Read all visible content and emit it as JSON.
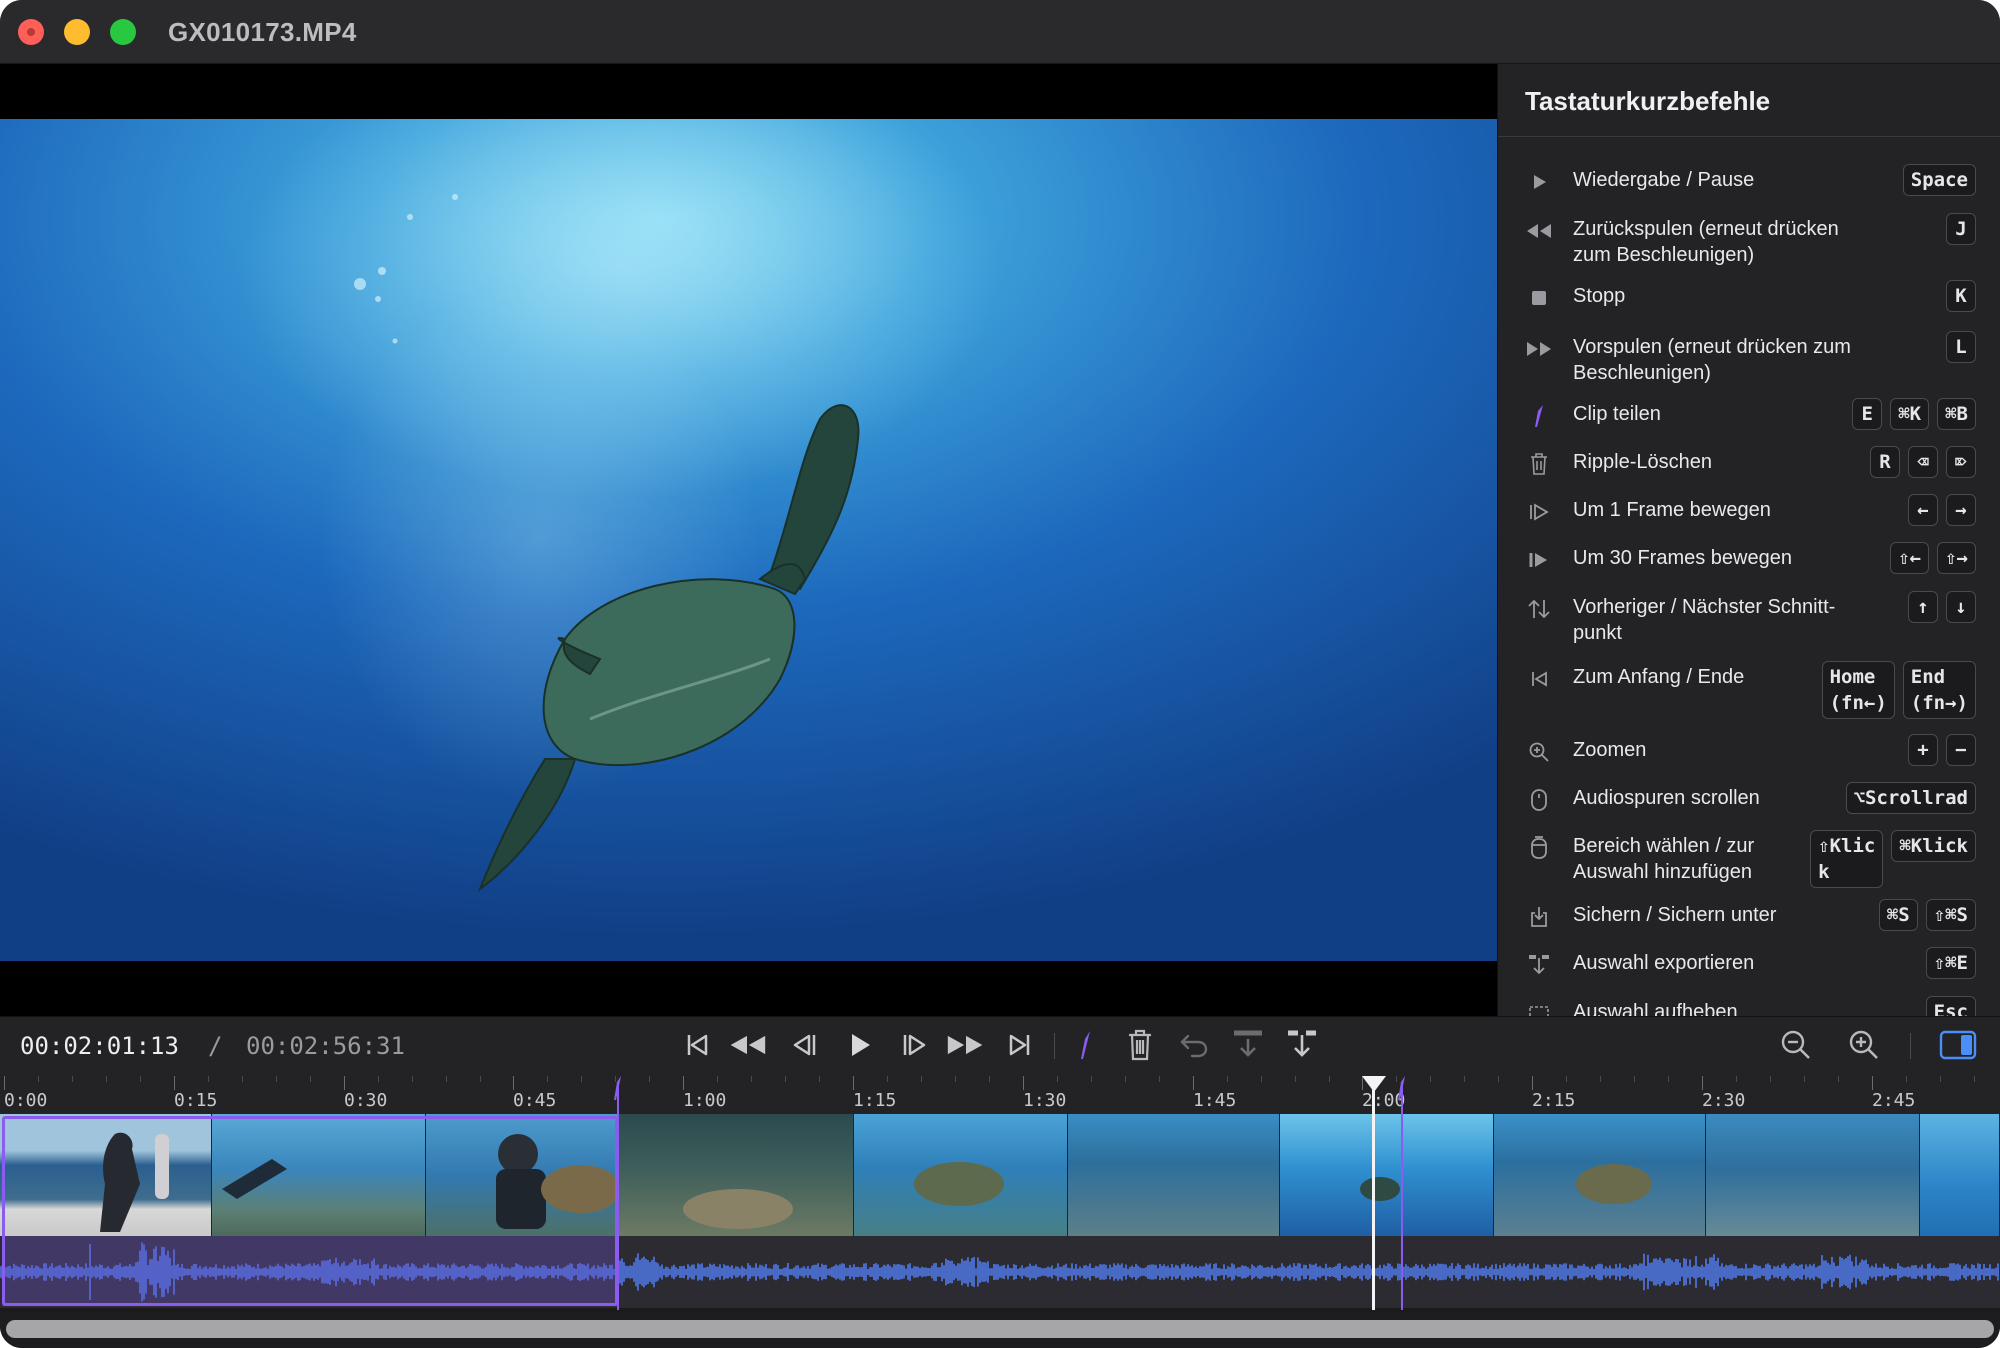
{
  "window": {
    "title": "GX010173.MP4"
  },
  "panel": {
    "title": "Tastaturkurzbefehle",
    "shortcuts": [
      {
        "icon": "play-icon",
        "label": "Wiedergabe / Pause",
        "keys": [
          "Space"
        ]
      },
      {
        "icon": "rewind-icon",
        "label": "Zurückspulen (erneut drücken zum Beschleunigen)",
        "keys": [
          "J"
        ]
      },
      {
        "icon": "stop-icon",
        "label": "Stopp",
        "keys": [
          "K"
        ]
      },
      {
        "icon": "fast-forward-icon",
        "label": "Vorspulen (erneut drücken zum Beschleunigen)",
        "keys": [
          "L"
        ]
      },
      {
        "icon": "split-clip-icon",
        "label": "Clip teilen",
        "keys": [
          "E",
          "⌘K",
          "⌘B"
        ]
      },
      {
        "icon": "trash-icon",
        "label": "Ripple-Löschen",
        "keys": [
          "R",
          "⌫",
          "⌦"
        ]
      },
      {
        "icon": "frame-step-icon",
        "label": "Um 1 Frame bewegen",
        "keys": [
          "←",
          "→"
        ]
      },
      {
        "icon": "frame-jump-icon",
        "label": "Um 30 Frames bewegen",
        "keys": [
          "⇧←",
          "⇧→"
        ]
      },
      {
        "icon": "up-down-arrows-icon",
        "label": "Vorheriger / Nächster Schnitt-punkt",
        "keys": [
          "↑",
          "↓"
        ]
      },
      {
        "icon": "skip-to-start-icon",
        "label": "Zum Anfang / Ende",
        "keys": [
          "Home\n(fn←)",
          "End\n(fn→)"
        ]
      },
      {
        "icon": "zoom-icon",
        "label": "Zoomen",
        "keys": [
          "+",
          "−"
        ]
      },
      {
        "icon": "mouse-icon",
        "label": "Audiospuren scrollen",
        "keys": [
          "⌥Scrollrad"
        ]
      },
      {
        "icon": "mouse-click-icon",
        "label": "Bereich wählen / zur Auswahl hinzufügen",
        "keys": [
          "⇧Klic\nk",
          "⌘Klick"
        ]
      },
      {
        "icon": "save-icon",
        "label": "Sichern / Sichern unter",
        "keys": [
          "⌘S",
          "⇧⌘S"
        ]
      },
      {
        "icon": "export-icon",
        "label": "Auswahl exportieren",
        "keys": [
          "⇧⌘E"
        ]
      },
      {
        "icon": "deselect-icon",
        "label": "Auswahl aufheben",
        "keys": [
          "Esc"
        ]
      }
    ]
  },
  "transport": {
    "current_time": "00:02:01:13",
    "separator": "/",
    "total_time": "00:02:56:31"
  },
  "timeline": {
    "ticks": [
      "0:00",
      "0:15",
      "0:30",
      "0:45",
      "1:00",
      "1:15",
      "1:30",
      "1:45",
      "2:00",
      "2:15",
      "2:30",
      "2:45"
    ]
  },
  "colors": {
    "accent": "#8a5cf0",
    "waveform": "#4f7bea",
    "selection_toggle": "#4a8ff7"
  }
}
